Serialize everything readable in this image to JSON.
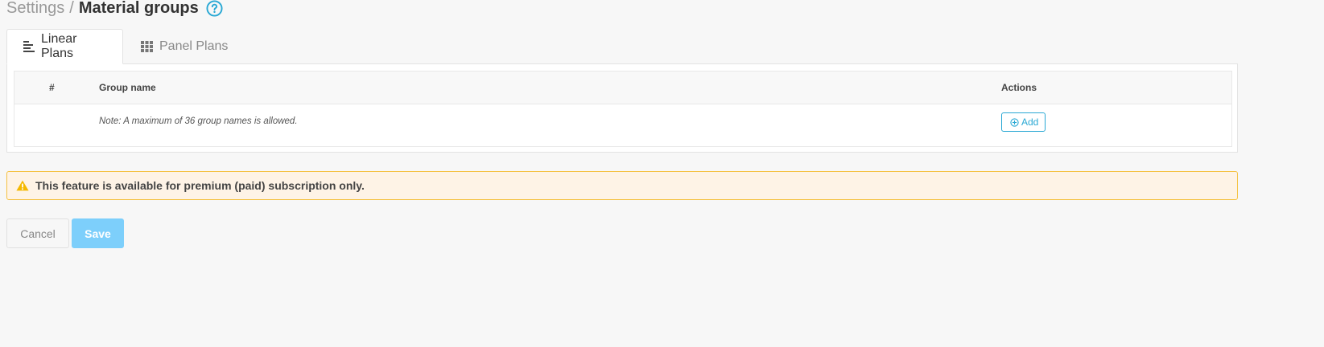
{
  "breadcrumb": {
    "parent": "Settings",
    "separator": "/",
    "current": "Material groups",
    "help_icon": "question-circle-icon"
  },
  "tabs": [
    {
      "label": "Linear Plans",
      "icon": "align-left-icon",
      "active": true
    },
    {
      "label": "Panel Plans",
      "icon": "grid-icon",
      "active": false
    }
  ],
  "table": {
    "columns": {
      "number": "#",
      "group_name": "Group name",
      "actions": "Actions"
    },
    "note": "Note: A maximum of 36 group names is allowed.",
    "add_label": "Add",
    "add_icon": "plus-circle-icon"
  },
  "alert": {
    "icon": "warning-triangle-icon",
    "text": "This feature is available for premium (paid) subscription only."
  },
  "actions": {
    "cancel_label": "Cancel",
    "save_label": "Save"
  },
  "colors": {
    "accent": "#29a8d4",
    "save_button": "#7dcffb",
    "alert_background": "#fef3e6",
    "alert_border": "#f5c243",
    "warning_icon": "#f5b800"
  }
}
